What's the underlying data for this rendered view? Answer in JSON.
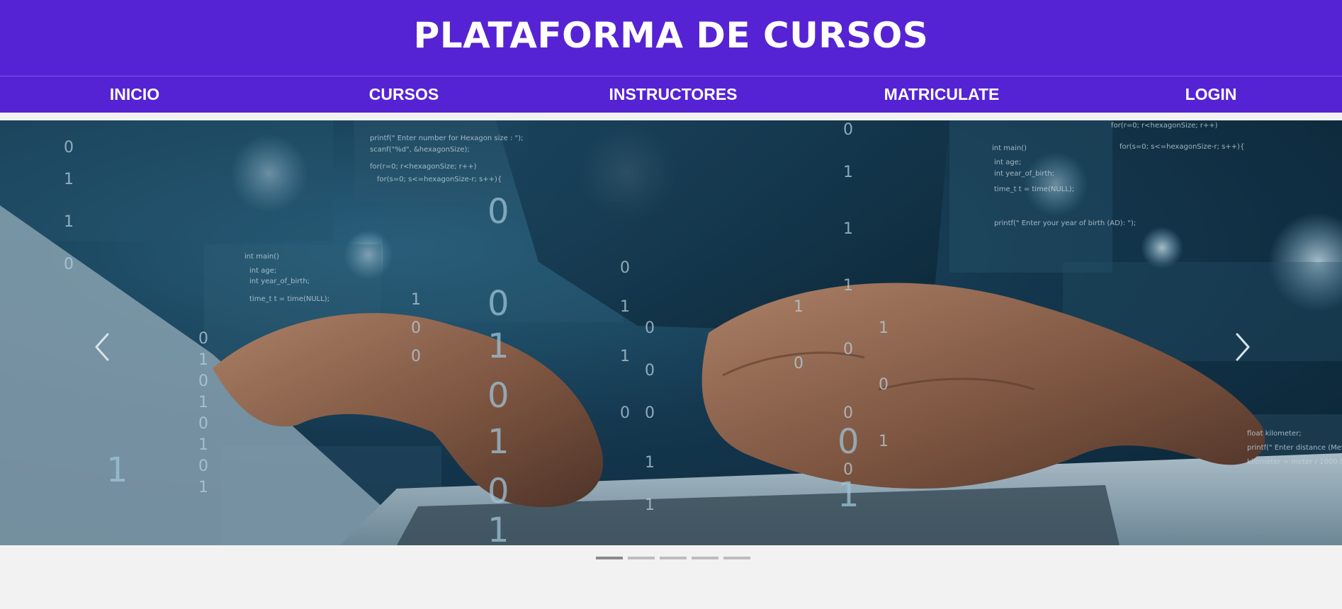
{
  "header": {
    "title": "PLATAFORMA DE CURSOS"
  },
  "nav": {
    "items": [
      {
        "label": "INICIO"
      },
      {
        "label": "CURSOS"
      },
      {
        "label": "INSTRUCTORES"
      },
      {
        "label": "MATRICULATE"
      },
      {
        "label": "LOGIN"
      }
    ]
  },
  "carousel": {
    "prev_icon": "chevron-left-icon",
    "next_icon": "chevron-right-icon",
    "slide_count": 5,
    "active_slide": 1,
    "image": "programmer-hands-typing-laptop-binary-code-overlay"
  },
  "colors": {
    "brand": "#5523d4",
    "background": "#f3f2f2",
    "indicator": "#bdbdbd",
    "indicator_active": "#8a8a8a"
  }
}
